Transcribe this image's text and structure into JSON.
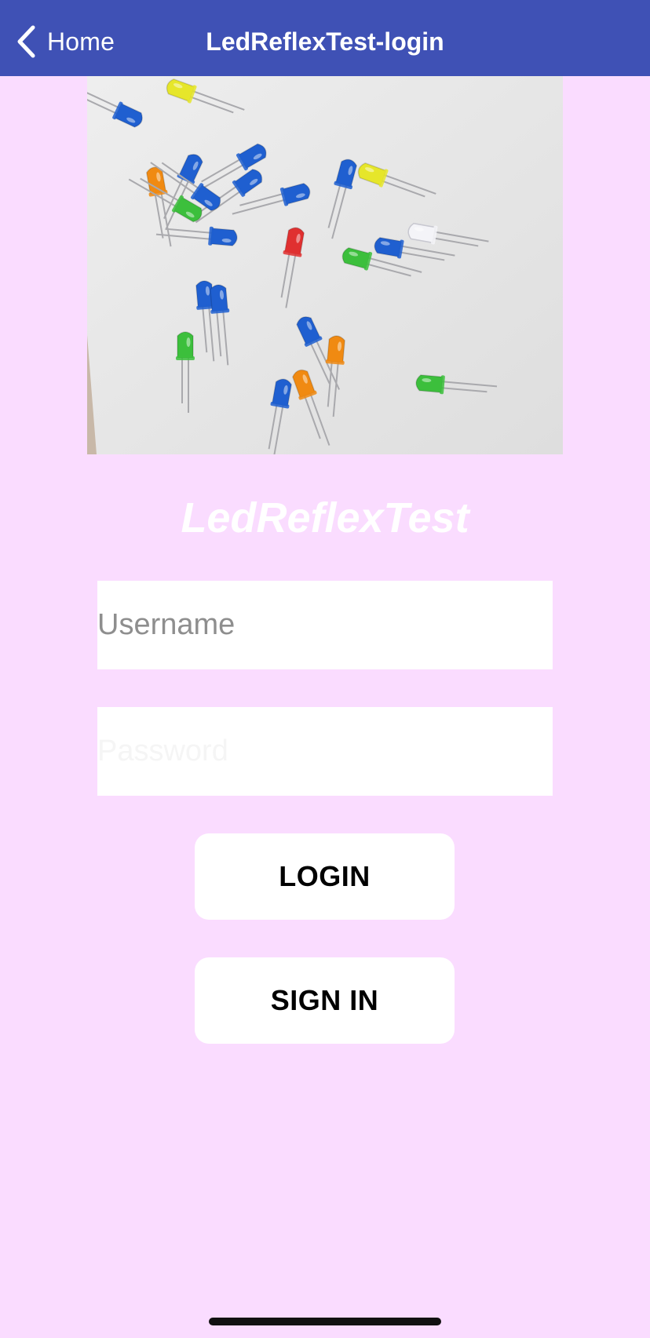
{
  "colors": {
    "navbar_bg": "#3f51b5",
    "page_bg": "#fadcff",
    "photo_bg": "#e6e6e6"
  },
  "navbar": {
    "back_label": "Home",
    "back_icon": "chevron-left-icon",
    "title": "LedReflexTest-login"
  },
  "hero_image": {
    "content": "photo of colored LEDs scattered on a white surface"
  },
  "app_name": "LedReflexTest",
  "form": {
    "username_placeholder": "Username",
    "username_value": "",
    "password_placeholder": "Password",
    "password_value": ""
  },
  "buttons": {
    "login_label": "LOGIN",
    "signin_label": "SIGN IN"
  }
}
